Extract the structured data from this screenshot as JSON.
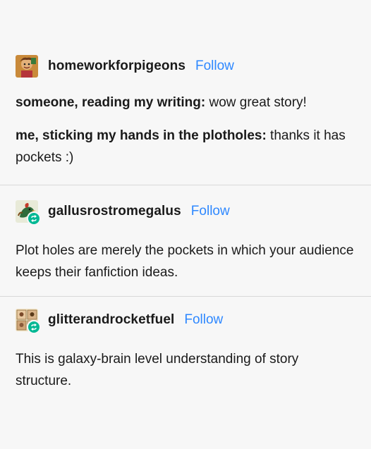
{
  "posts": [
    {
      "username": "homeworkforpigeons",
      "follow_label": "Follow",
      "avatar_icon": "cartoon-character-avatar",
      "lines": [
        {
          "bold": "someone, reading my writing:",
          "text": " wow great story!"
        },
        {
          "bold": "me, sticking my hands in the plotholes:",
          "text": " thanks it has pockets :)"
        }
      ]
    },
    {
      "username": "gallusrostromegalus",
      "follow_label": "Follow",
      "avatar_icon": "bird-avatar",
      "reblog_icon": "reblog-icon",
      "text": "Plot holes are merely the pockets in which your audience keeps their fanfiction ideas."
    },
    {
      "username": "glitterandrocketfuel",
      "follow_label": "Follow",
      "avatar_icon": "comic-collage-avatar",
      "reblog_icon": "reblog-icon",
      "text": "This is galaxy-brain level understanding of story structure."
    }
  ],
  "colors": {
    "background": "#f7f7f7",
    "text": "#1a1a1a",
    "follow": "#2e88ff",
    "reblog_badge": "#00b894",
    "divider": "#d9d9d9"
  }
}
